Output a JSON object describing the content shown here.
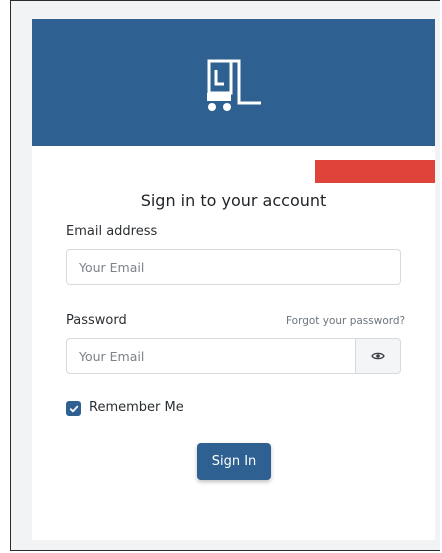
{
  "header": {
    "logo_icon": "forklift-icon",
    "background_color": "#2e6191"
  },
  "form": {
    "title": "Sign in to your account",
    "email": {
      "label": "Email address",
      "placeholder": "Your Email",
      "value": ""
    },
    "password": {
      "label": "Password",
      "placeholder": "Your Email",
      "value": "",
      "forgot_link": "Forgot your password?",
      "toggle_icon": "eye-icon"
    },
    "remember_me": {
      "label": "Remember Me",
      "checked": true
    },
    "submit_label": "Sign In"
  },
  "colors": {
    "accent": "#2e6191",
    "error_banner": "#e0433a"
  }
}
